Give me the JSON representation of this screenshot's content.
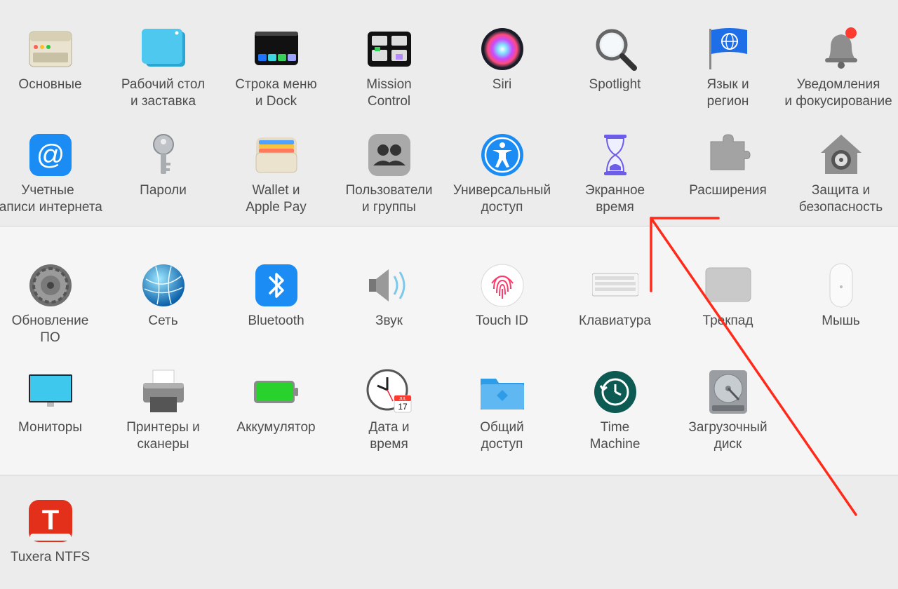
{
  "sections": [
    {
      "name": "personal",
      "items": [
        {
          "id": "general",
          "label": "Основные",
          "icon": "general-window-icon"
        },
        {
          "id": "desktop",
          "label": "Рабочий стол\nи заставка",
          "icon": "desktop-screensaver-icon"
        },
        {
          "id": "dock",
          "label": "Строка меню\nи Dock",
          "icon": "menubar-dock-icon"
        },
        {
          "id": "mission-control",
          "label": "Mission\nControl",
          "icon": "mission-control-icon"
        },
        {
          "id": "siri",
          "label": "Siri",
          "icon": "siri-icon"
        },
        {
          "id": "spotlight",
          "label": "Spotlight",
          "icon": "magnifier-icon"
        },
        {
          "id": "language",
          "label": "Язык и\nрегион",
          "icon": "globe-flag-icon"
        },
        {
          "id": "notifications",
          "label": "Уведомления\nи фокусирование",
          "icon": "bell-icon"
        },
        {
          "id": "internet-accounts",
          "label": "Учетные\nзаписи интернета",
          "icon": "at-sign-icon"
        },
        {
          "id": "passwords",
          "label": "Пароли",
          "icon": "key-icon"
        },
        {
          "id": "wallet",
          "label": "Wallet и\nApple Pay",
          "icon": "wallet-icon"
        },
        {
          "id": "users",
          "label": "Пользователи\nи группы",
          "icon": "users-icon"
        },
        {
          "id": "accessibility",
          "label": "Универсальный\nдоступ",
          "icon": "accessibility-icon"
        },
        {
          "id": "screen-time",
          "label": "Экранное\nвремя",
          "icon": "hourglass-icon"
        },
        {
          "id": "extensions",
          "label": "Расширения",
          "icon": "puzzle-icon"
        },
        {
          "id": "security",
          "label": "Защита и\nбезопасность",
          "icon": "house-lock-icon"
        }
      ]
    },
    {
      "name": "hardware",
      "items": [
        {
          "id": "software-update",
          "label": "Обновление\nПО",
          "icon": "gear-icon"
        },
        {
          "id": "network",
          "label": "Сеть",
          "icon": "network-globe-icon"
        },
        {
          "id": "bluetooth",
          "label": "Bluetooth",
          "icon": "bluetooth-icon"
        },
        {
          "id": "sound",
          "label": "Звук",
          "icon": "speaker-icon"
        },
        {
          "id": "touch-id",
          "label": "Touch ID",
          "icon": "fingerprint-icon"
        },
        {
          "id": "keyboard",
          "label": "Клавиатура",
          "icon": "keyboard-icon"
        },
        {
          "id": "trackpad",
          "label": "Трекпад",
          "icon": "trackpad-icon"
        },
        {
          "id": "mouse",
          "label": "Мышь",
          "icon": "mouse-icon"
        },
        {
          "id": "displays",
          "label": "Мониторы",
          "icon": "monitor-icon"
        },
        {
          "id": "printers",
          "label": "Принтеры и\nсканеры",
          "icon": "printer-icon"
        },
        {
          "id": "battery",
          "label": "Аккумулятор",
          "icon": "battery-icon"
        },
        {
          "id": "date-time",
          "label": "Дата и\nвремя",
          "icon": "clock-calendar-icon",
          "calendar_month": "JUL",
          "calendar_day": "17"
        },
        {
          "id": "sharing",
          "label": "Общий\nдоступ",
          "icon": "sharing-folder-icon"
        },
        {
          "id": "time-machine",
          "label": "Time\nMachine",
          "icon": "time-machine-icon"
        },
        {
          "id": "startup-disk",
          "label": "Загрузочный\nдиск",
          "icon": "hard-disk-icon"
        }
      ]
    },
    {
      "name": "other",
      "items": [
        {
          "id": "tuxera",
          "label": "Tuxera NTFS",
          "icon": "tuxera-t-icon",
          "icon_letter": "T"
        }
      ]
    }
  ],
  "annotation": {
    "icon": "red-arrow-annotation",
    "color": "#ff2a1a"
  }
}
